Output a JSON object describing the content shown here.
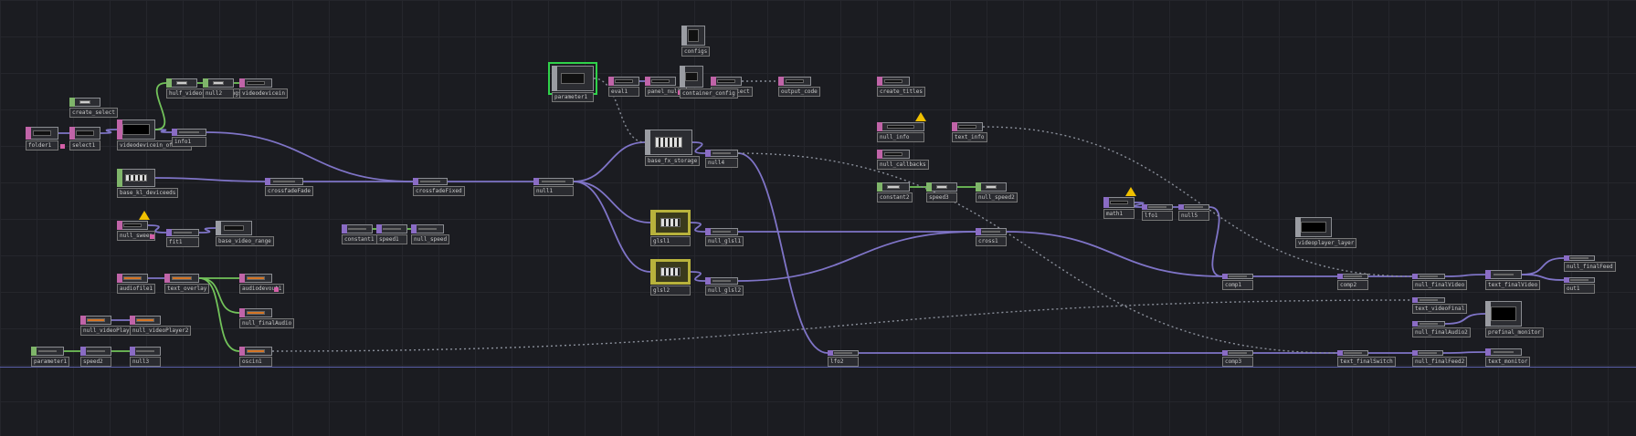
{
  "colors": {
    "background": "#1b1c21",
    "wire": "#7f74c7",
    "wire_green": "#72c25a",
    "wire_dotted": "#8a8f9a",
    "selected": "#2fd24a",
    "warning": "#f0c000"
  },
  "family_colors": {
    "TOP": "#c064a8",
    "CHOP": "#8a6cc4",
    "DAT": "#7fb56a",
    "COMP": "#9a9ca2",
    "MAT": "#b8b23c"
  },
  "nodes": [
    {
      "id": "n1",
      "label": "folder1",
      "family": "TOP",
      "viewer": "dark"
    },
    {
      "id": "n2",
      "label": "select1",
      "family": "TOP",
      "viewer": "dark"
    },
    {
      "id": "n3",
      "label": "create_select",
      "family": "DAT",
      "viewer": "text"
    },
    {
      "id": "n4",
      "label": "videodevicein_offline",
      "family": "TOP",
      "viewer": "black"
    },
    {
      "id": "n5",
      "label": "info1",
      "family": "CHOP",
      "viewer": "chop"
    },
    {
      "id": "n6",
      "label": "hulf_videos_recordings",
      "family": "DAT",
      "viewer": "text"
    },
    {
      "id": "n7",
      "label": "null2",
      "family": "DAT",
      "viewer": "text"
    },
    {
      "id": "n8",
      "label": "videodevicein",
      "family": "TOP",
      "viewer": "dark"
    },
    {
      "id": "n9",
      "label": "base_kl_deviceeds",
      "family": "DAT",
      "viewer": "pattern"
    },
    {
      "id": "n10",
      "label": "crossfadeFade",
      "family": "CHOP",
      "viewer": "chop"
    },
    {
      "id": "n11",
      "label": "crossfadeFixed",
      "family": "CHOP",
      "viewer": "chop"
    },
    {
      "id": "n12",
      "label": "null1",
      "family": "CHOP",
      "viewer": "chop"
    },
    {
      "id": "n13",
      "label": "constant1",
      "family": "CHOP",
      "viewer": "chop"
    },
    {
      "id": "n14",
      "label": "speed1",
      "family": "CHOP",
      "viewer": "chop"
    },
    {
      "id": "n15",
      "label": "null_speed",
      "family": "CHOP",
      "viewer": "chop"
    },
    {
      "id": "n16",
      "label": "null_sweep",
      "family": "TOP",
      "viewer": "dark"
    },
    {
      "id": "n17",
      "label": "fit1",
      "family": "CHOP",
      "viewer": "chop"
    },
    {
      "id": "n18",
      "label": "base_video_range",
      "family": "COMP",
      "viewer": "dark"
    },
    {
      "id": "n19",
      "label": "audiofile1",
      "family": "TOP",
      "viewer": "flag"
    },
    {
      "id": "n20",
      "label": "text_overlay",
      "family": "TOP",
      "viewer": "flag"
    },
    {
      "id": "n21",
      "label": "audiodevout1",
      "family": "TOP",
      "viewer": "flag"
    },
    {
      "id": "n22",
      "label": "null_finalAudio",
      "family": "TOP",
      "viewer": "flag"
    },
    {
      "id": "n23",
      "label": "oscin1",
      "family": "TOP",
      "viewer": "flag"
    },
    {
      "id": "n24",
      "label": "null_videoPlayer",
      "family": "TOP",
      "viewer": "flag"
    },
    {
      "id": "n25",
      "label": "null_videoPlayer2",
      "family": "TOP",
      "viewer": "flag"
    },
    {
      "id": "n26",
      "label": "parameter1",
      "family": "DAT",
      "viewer": "chop"
    },
    {
      "id": "n27",
      "label": "speed2",
      "family": "CHOP",
      "viewer": "chop"
    },
    {
      "id": "n28",
      "label": "null3",
      "family": "CHOP",
      "viewer": "chop"
    },
    {
      "id": "n29",
      "label": "parameter1",
      "family": "COMP",
      "viewer": "dark"
    },
    {
      "id": "n30",
      "label": "eval1",
      "family": "TOP",
      "viewer": "dark"
    },
    {
      "id": "n31",
      "label": "panel_null1",
      "family": "TOP",
      "viewer": "dark"
    },
    {
      "id": "n32",
      "label": "configs",
      "family": "COMP",
      "viewer": "tall"
    },
    {
      "id": "n33",
      "label": "null_select",
      "family": "TOP",
      "viewer": "dark"
    },
    {
      "id": "n34",
      "label": "output_code",
      "family": "TOP",
      "viewer": "dark"
    },
    {
      "id": "n35",
      "label": "container_config",
      "family": "COMP",
      "viewer": "dark"
    },
    {
      "id": "n36",
      "label": "base_fx_storage",
      "family": "COMP",
      "viewer": "pattern"
    },
    {
      "id": "n37",
      "label": "null4",
      "family": "CHOP",
      "viewer": "chop"
    },
    {
      "id": "n38",
      "label": "glsl1",
      "family": "MAT",
      "viewer": "pattern"
    },
    {
      "id": "n39",
      "label": "null_glsl1",
      "family": "CHOP",
      "viewer": "chop"
    },
    {
      "id": "n40",
      "label": "glsl2",
      "family": "MAT",
      "viewer": "pattern"
    },
    {
      "id": "n41",
      "label": "null_glsl2",
      "family": "CHOP",
      "viewer": "chop"
    },
    {
      "id": "n42",
      "label": "create_titles",
      "family": "TOP",
      "viewer": "dark"
    },
    {
      "id": "n43",
      "label": "null_info",
      "family": "TOP",
      "viewer": "dark"
    },
    {
      "id": "n44",
      "label": "text_info",
      "family": "TOP",
      "viewer": "dark"
    },
    {
      "id": "n45",
      "label": "null_callbacks",
      "family": "TOP",
      "viewer": "dark"
    },
    {
      "id": "n46",
      "label": "constant2",
      "family": "DAT",
      "viewer": "text"
    },
    {
      "id": "n47",
      "label": "speed3",
      "family": "DAT",
      "viewer": "text"
    },
    {
      "id": "n48",
      "label": "null_speed2",
      "family": "DAT",
      "viewer": "text"
    },
    {
      "id": "n49",
      "label": "cross1",
      "family": "CHOP",
      "viewer": "chop"
    },
    {
      "id": "n50",
      "label": "math1",
      "family": "CHOP",
      "viewer": "dark"
    },
    {
      "id": "n51",
      "label": "lfo1",
      "family": "CHOP",
      "viewer": "chop"
    },
    {
      "id": "n52",
      "label": "null5",
      "family": "CHOP",
      "viewer": "chop"
    },
    {
      "id": "n53",
      "label": "videoplayer_layer",
      "family": "COMP",
      "viewer": "black"
    },
    {
      "id": "n54",
      "label": "comp1",
      "family": "CHOP",
      "viewer": "chop"
    },
    {
      "id": "n55",
      "label": "comp2",
      "family": "CHOP",
      "viewer": "chop"
    },
    {
      "id": "n56",
      "label": "null_finalVideo",
      "family": "CHOP",
      "viewer": "chop"
    },
    {
      "id": "n57",
      "label": "text_finalVideo",
      "family": "CHOP",
      "viewer": "chop"
    },
    {
      "id": "n58",
      "label": "text_videoFinal",
      "family": "CHOP",
      "viewer": "chop"
    },
    {
      "id": "n59",
      "label": "null_finalAudio2",
      "family": "CHOP",
      "viewer": "chop"
    },
    {
      "id": "n60",
      "label": "prefinal_monitor",
      "family": "COMP",
      "viewer": "black"
    },
    {
      "id": "n61",
      "label": "null_finalFeed",
      "family": "CHOP",
      "viewer": "chop"
    },
    {
      "id": "n62",
      "label": "out1",
      "family": "CHOP",
      "viewer": "chop"
    },
    {
      "id": "n63",
      "label": "lfo2",
      "family": "CHOP",
      "viewer": "chop"
    },
    {
      "id": "n64",
      "label": "comp3",
      "family": "CHOP",
      "viewer": "chop"
    },
    {
      "id": "n65",
      "label": "text_finalSwitch",
      "family": "CHOP",
      "viewer": "chop"
    },
    {
      "id": "n66",
      "label": "null_finalFeed2",
      "family": "CHOP",
      "viewer": "chop"
    },
    {
      "id": "n67",
      "label": "text_monitor",
      "family": "CHOP",
      "viewer": "chop"
    }
  ]
}
